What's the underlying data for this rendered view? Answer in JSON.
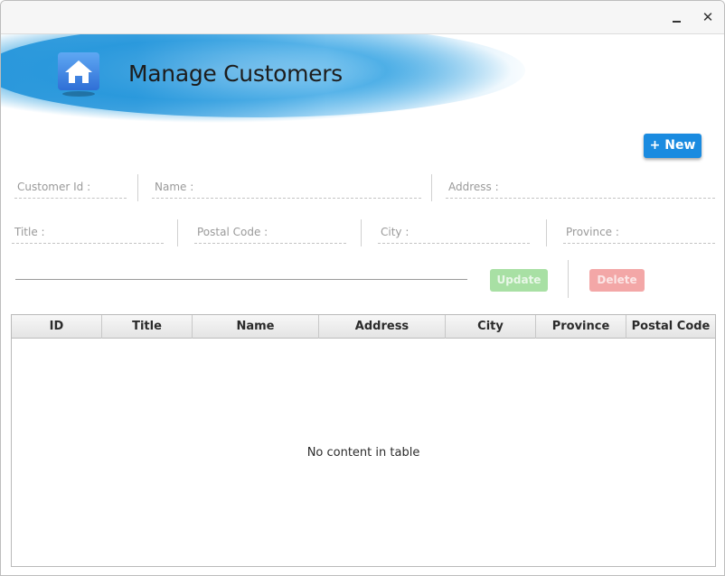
{
  "window": {
    "minimize_glyph": "minimize-icon",
    "close_label": "✕"
  },
  "header": {
    "title": "Manage Customers",
    "icon": "home-icon"
  },
  "toolbar": {
    "new_label": "+ New"
  },
  "form": {
    "customer_id": {
      "placeholder": "Customer Id :"
    },
    "name": {
      "placeholder": "Name :"
    },
    "address": {
      "placeholder": "Address :"
    },
    "title": {
      "placeholder": "Title :"
    },
    "postal_code": {
      "placeholder": "Postal Code :"
    },
    "city": {
      "placeholder": "City :"
    },
    "province": {
      "placeholder": "Province :"
    },
    "search": {
      "value": ""
    }
  },
  "actions": {
    "update_label": "Update",
    "delete_label": "Delete"
  },
  "table": {
    "columns": [
      "ID",
      "Title",
      "Name",
      "Address",
      "City",
      "Province",
      "Postal Code"
    ],
    "empty_message": "No content in table"
  },
  "colors": {
    "accent": "#1a8be0",
    "update_disabled": "#a8e0a4",
    "delete_disabled": "#f3a7a7",
    "banner": "#2d9fdf"
  }
}
